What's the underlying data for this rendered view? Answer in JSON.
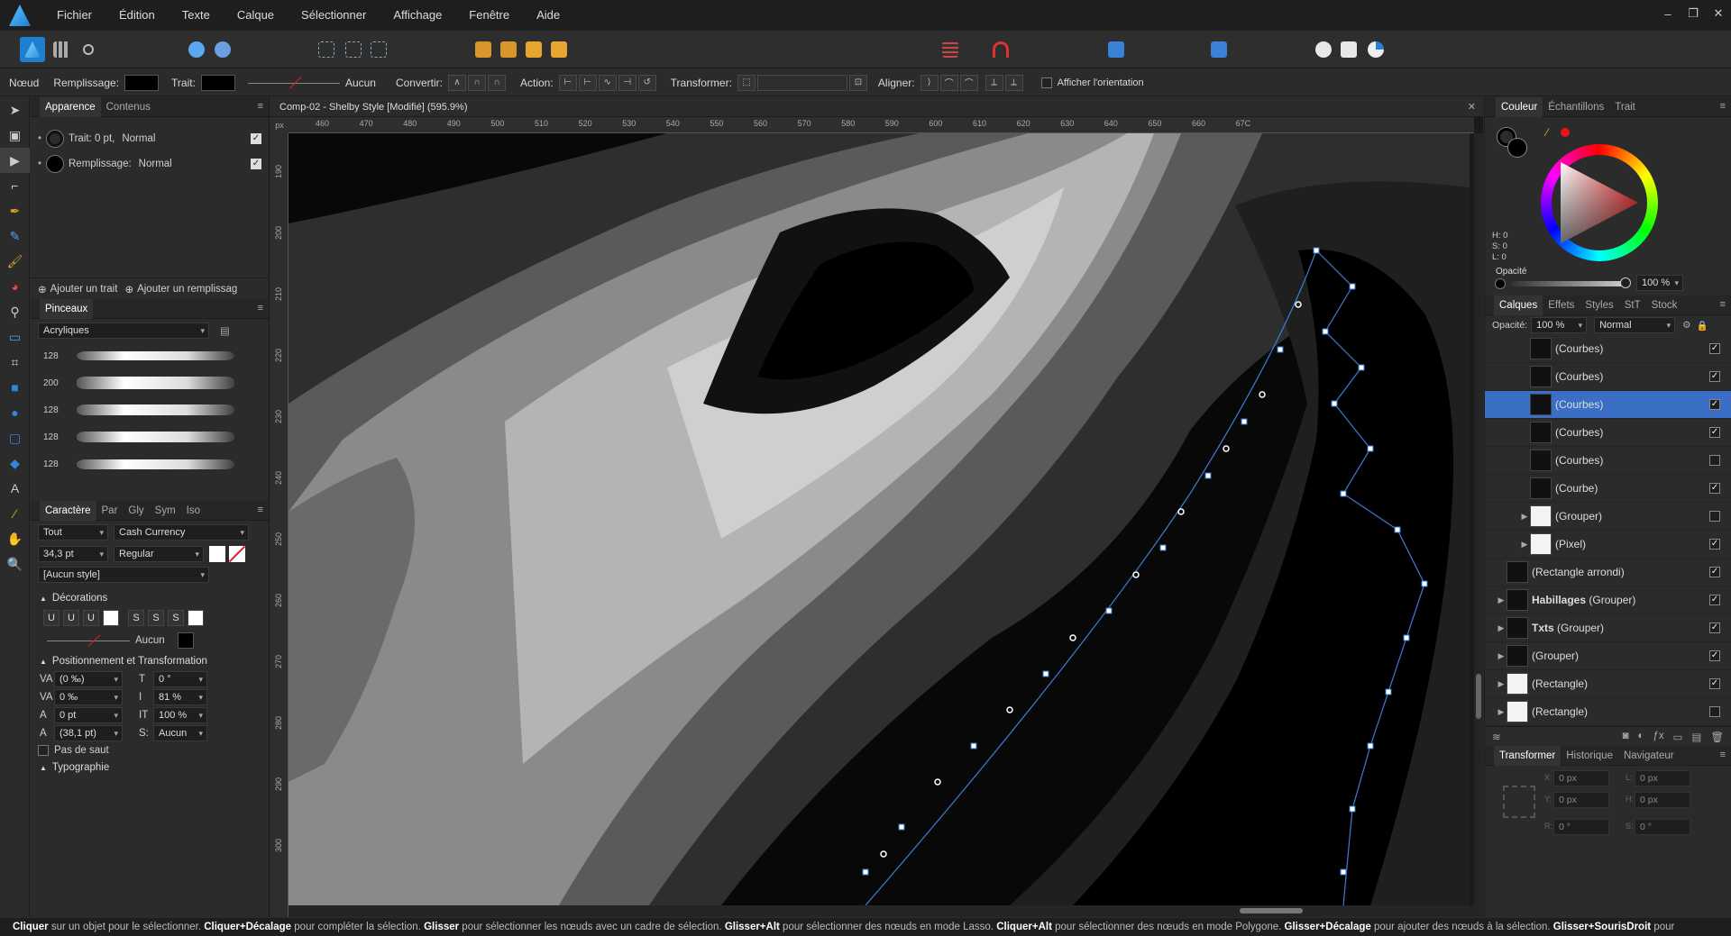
{
  "menu": [
    "Fichier",
    "Édition",
    "Texte",
    "Calque",
    "Sélectionner",
    "Affichage",
    "Fenêtre",
    "Aide"
  ],
  "window_controls": [
    "–",
    "❐",
    "✕"
  ],
  "context": {
    "tool_name": "Nœud",
    "fill_label": "Remplissage:",
    "stroke_label": "Trait:",
    "stroke_style": "Aucun",
    "convert_label": "Convertir:",
    "action_label": "Action:",
    "transform_label": "Transformer:",
    "align_label": "Aligner:",
    "show_orientation": "Afficher l'orientation"
  },
  "appearance_panel": {
    "tabs": [
      "Apparence",
      "Contenus"
    ],
    "stroke_item": "Trait: 0 pt,",
    "stroke_blend": "Normal",
    "fill_item": "Remplissage:",
    "fill_blend": "Normal",
    "add_stroke": "Ajouter un trait",
    "add_fill": "Ajouter un remplissag"
  },
  "brushes_panel": {
    "tab": "Pinceaux",
    "category": "Acryliques",
    "sizes": [
      "128",
      "200",
      "128",
      "128",
      "128"
    ]
  },
  "character_panel": {
    "tabs": [
      "Caractère",
      "Par",
      "Gly",
      "Sym",
      "Iso"
    ],
    "scope": "Tout",
    "font": "Cash Currency",
    "size": "34,3 pt",
    "weight": "Regular",
    "style": "[Aucun style]",
    "decorations_title": "Décorations",
    "deco_buttons": [
      "U",
      "U",
      "U",
      "S",
      "S",
      "S"
    ],
    "deco_stroke": "Aucun",
    "pos_title": "Positionnement et Transformation",
    "fields": {
      "tracking": "(0 ‰)",
      "skew": "0 °",
      "kerning": "0 ‰",
      "vscale": "81 %",
      "baseline": "0 pt",
      "hscale": "100 %",
      "leading": "(38,1 pt)",
      "sub": "Aucun"
    },
    "no_break": "Pas de saut",
    "typography_title": "Typographie"
  },
  "document": {
    "tab_title": "Comp-02 - Shelby Style [Modifié] (595.9%)",
    "ruler_h": [
      "460",
      "470",
      "480",
      "490",
      "500",
      "510",
      "520",
      "530",
      "540",
      "550",
      "560",
      "570",
      "580",
      "590",
      "600",
      "610",
      "620",
      "630",
      "640",
      "650",
      "660",
      "67C"
    ],
    "ruler_v": [
      "190",
      "200",
      "210",
      "220",
      "230",
      "240",
      "250",
      "260",
      "270",
      "280",
      "290",
      "300"
    ],
    "ruler_unit": "px"
  },
  "color_panel": {
    "tabs": [
      "Couleur",
      "Échantillons",
      "Trait"
    ],
    "h": "H: 0",
    "s": "S: 0",
    "l": "L: 0",
    "opacity_label": "Opacité",
    "opacity_value": "100 %"
  },
  "layers_panel": {
    "tabs": [
      "Calques",
      "Effets",
      "Styles",
      "StT",
      "Stock"
    ],
    "opacity_label": "Opacité:",
    "opacity_value": "100 %",
    "blend": "Normal",
    "layers": [
      {
        "name": "(Courbes)",
        "bold": "",
        "indent": 1,
        "expander": "",
        "thumb": "dark",
        "checked": true,
        "selected": false
      },
      {
        "name": "(Courbes)",
        "bold": "",
        "indent": 1,
        "expander": "",
        "thumb": "dark",
        "checked": true,
        "selected": false
      },
      {
        "name": "(Courbes)",
        "bold": "",
        "indent": 1,
        "expander": "",
        "thumb": "dark",
        "checked": true,
        "selected": true
      },
      {
        "name": "(Courbes)",
        "bold": "",
        "indent": 1,
        "expander": "",
        "thumb": "dark",
        "checked": true,
        "selected": false
      },
      {
        "name": "(Courbes)",
        "bold": "",
        "indent": 1,
        "expander": "",
        "thumb": "dark",
        "checked": false,
        "selected": false
      },
      {
        "name": "(Courbe)",
        "bold": "",
        "indent": 1,
        "expander": "",
        "thumb": "dark",
        "checked": true,
        "selected": false
      },
      {
        "name": "(Grouper)",
        "bold": "",
        "indent": 1,
        "expander": "▶",
        "thumb": "white",
        "checked": false,
        "selected": false
      },
      {
        "name": "(Pixel)",
        "bold": "",
        "indent": 1,
        "expander": "▶",
        "thumb": "white",
        "checked": true,
        "selected": false
      },
      {
        "name": "(Rectangle arrondi)",
        "bold": "",
        "indent": 0,
        "expander": "",
        "thumb": "dark",
        "checked": true,
        "selected": false
      },
      {
        "name": " (Grouper)",
        "bold": "Habillages",
        "indent": 0,
        "expander": "▶",
        "thumb": "dark",
        "checked": true,
        "selected": false
      },
      {
        "name": " (Grouper)",
        "bold": "Txts",
        "indent": 0,
        "expander": "▶",
        "thumb": "dark",
        "checked": true,
        "selected": false
      },
      {
        "name": "(Grouper)",
        "bold": "",
        "indent": 0,
        "expander": "▶",
        "thumb": "dark",
        "checked": true,
        "selected": false
      },
      {
        "name": "(Rectangle)",
        "bold": "",
        "indent": 0,
        "expander": "▶",
        "thumb": "white",
        "checked": true,
        "selected": false
      },
      {
        "name": "(Rectangle)",
        "bold": "",
        "indent": 0,
        "expander": "▶",
        "thumb": "white",
        "checked": false,
        "selected": false
      }
    ]
  },
  "transform_panel": {
    "tabs": [
      "Transformer",
      "Historique",
      "Navigateur"
    ],
    "x": "0 px",
    "y": "0 px",
    "w": "0 px",
    "h": "0 px",
    "r": "0 °",
    "s": "0 °",
    "x_label": "X:",
    "y_label": "Y:",
    "w_label": "L:",
    "h_label": "H:",
    "r_label": "R:",
    "s_label": "S:"
  },
  "status": [
    {
      "b": "Cliquer",
      "t": " sur un objet pour le sélectionner. "
    },
    {
      "b": "Cliquer+Décalage",
      "t": " pour compléter la sélection. "
    },
    {
      "b": "Glisser",
      "t": " pour sélectionner les nœuds avec un cadre de sélection. "
    },
    {
      "b": "Glisser+Alt",
      "t": " pour sélectionner des nœuds en mode Lasso. "
    },
    {
      "b": "Cliquer+Alt",
      "t": " pour sélectionner des nœuds en mode Polygone. "
    },
    {
      "b": "Glisser+Décalage",
      "t": " pour ajouter des nœuds à la sélection. "
    },
    {
      "b": "Glisser+SourisDroit",
      "t": " pour"
    }
  ]
}
